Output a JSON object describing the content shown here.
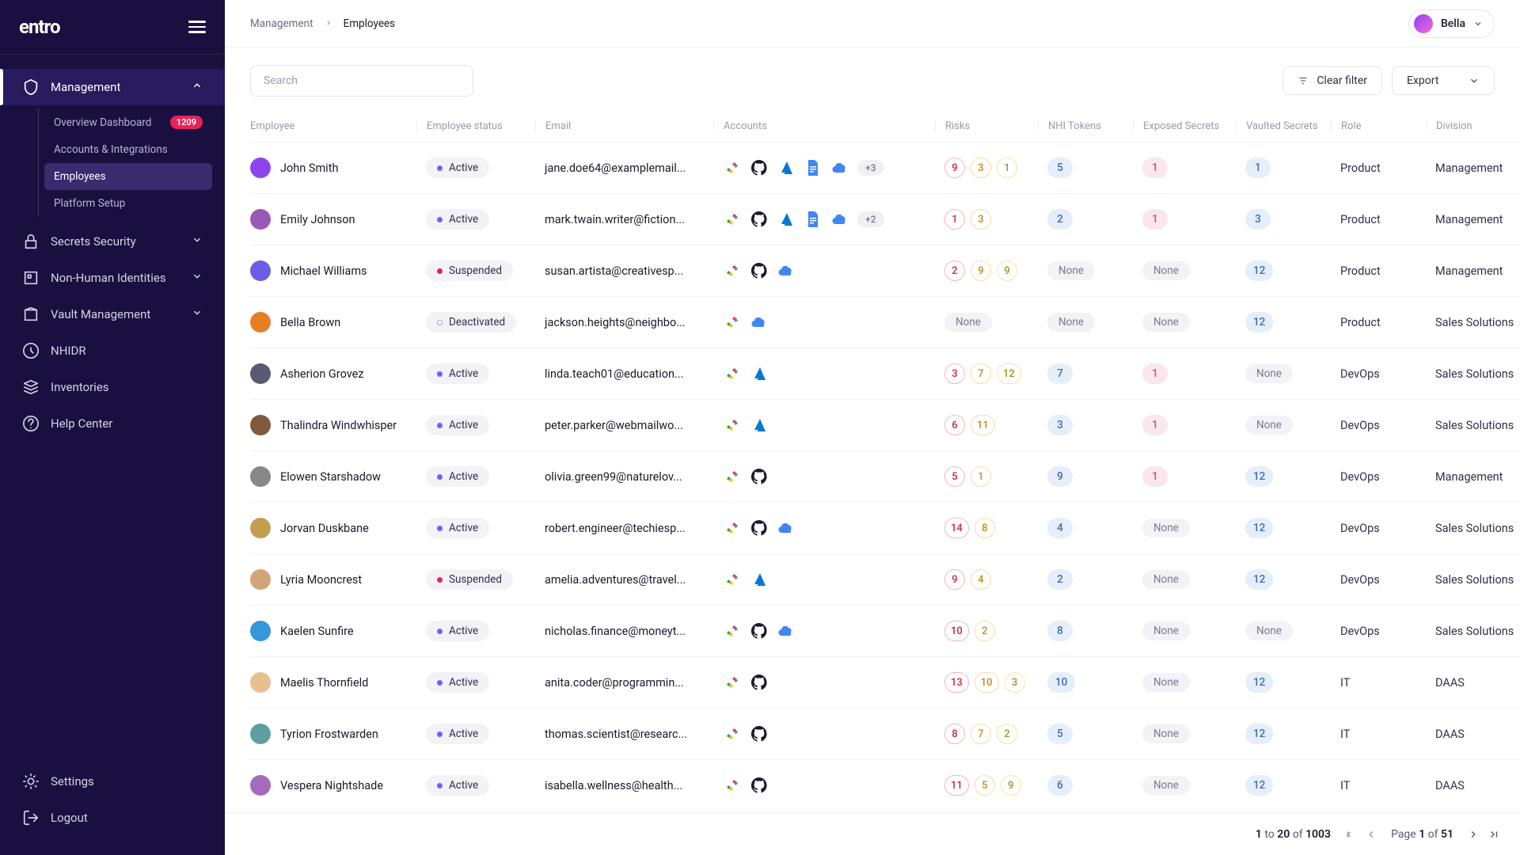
{
  "brand": "entro",
  "breadcrumb": {
    "root": "Management",
    "current": "Employees"
  },
  "user": {
    "name": "Bella",
    "avatarBg": "linear-gradient(135deg,#8e44ec,#f368e0)"
  },
  "sidebar": {
    "main": [
      {
        "label": "Management",
        "expanded": true,
        "active": true,
        "children": [
          {
            "label": "Overview Dashboard",
            "badge": "1209"
          },
          {
            "label": "Accounts & Integrations"
          },
          {
            "label": "Employees",
            "selected": true
          },
          {
            "label": "Platform Setup"
          }
        ]
      },
      {
        "label": "Secrets Security",
        "caret": true
      },
      {
        "label": "Non-Human Identities",
        "caret": true
      },
      {
        "label": "Vault Management",
        "caret": true
      },
      {
        "label": "NHIDR"
      },
      {
        "label": "Inventories"
      },
      {
        "label": "Help Center"
      }
    ],
    "bottom": [
      {
        "label": "Settings"
      },
      {
        "label": "Logout"
      }
    ]
  },
  "toolbar": {
    "searchPlaceholder": "Search",
    "clearFilter": "Clear filter",
    "export": "Export"
  },
  "columns": [
    "Employee",
    "Employee status",
    "Email",
    "Accounts",
    "Risks",
    "NHI Tokens",
    "Exposed Secrets",
    "Vaulted Secrets",
    "Role",
    "Division"
  ],
  "statuses": {
    "active": "Active",
    "suspended": "Suspended",
    "deactivated": "Deactivated"
  },
  "noneLabel": "None",
  "rows": [
    {
      "name": "John Smith",
      "avatarBg": "#8e44ec",
      "status": "active",
      "email": "jane.doe64@examplemail...",
      "accounts": [
        "gcloud",
        "github",
        "azure",
        "docs",
        "gcloud2"
      ],
      "more": "+3",
      "risks": [
        {
          "v": 9,
          "t": "red"
        },
        {
          "v": 3,
          "t": "orange"
        },
        {
          "v": 1,
          "t": "yellow"
        }
      ],
      "tokens": "5",
      "exposed": "1",
      "vaulted": "1",
      "role": "Product",
      "division": "Management"
    },
    {
      "name": "Emily Johnson",
      "avatarBg": "#9b59b6",
      "status": "active",
      "email": "mark.twain.writer@fiction...",
      "accounts": [
        "gcloud",
        "github",
        "azure",
        "docs",
        "gcloud2"
      ],
      "more": "+2",
      "risks": [
        {
          "v": 1,
          "t": "red"
        },
        {
          "v": 3,
          "t": "orange"
        }
      ],
      "tokens": "2",
      "exposed": "1",
      "vaulted": "3",
      "role": "Product",
      "division": "Management"
    },
    {
      "name": "Michael Williams",
      "avatarBg": "#6c5ce7",
      "status": "suspended",
      "email": "susan.artista@creativesp...",
      "accounts": [
        "gcloud",
        "github",
        "gcloud2"
      ],
      "risks": [
        {
          "v": 2,
          "t": "red"
        },
        {
          "v": 9,
          "t": "orange"
        },
        {
          "v": 9,
          "t": "yellow"
        }
      ],
      "tokens": "None",
      "exposed": "None",
      "vaulted": "12",
      "role": "Product",
      "division": "Management"
    },
    {
      "name": "Bella Brown",
      "avatarBg": "#e67e22",
      "status": "deactivated",
      "email": "jackson.heights@neighbo...",
      "accounts": [
        "gcloud",
        "gcloud2"
      ],
      "risks": [],
      "risksNone": true,
      "tokens": "None",
      "exposed": "None",
      "vaulted": "12",
      "role": "Product",
      "division": "Sales Solutions"
    },
    {
      "name": "Asherion Grovez",
      "avatarBg": "#5a5a72",
      "status": "active",
      "email": "linda.teach01@education...",
      "accounts": [
        "gcloud",
        "azure"
      ],
      "risks": [
        {
          "v": 3,
          "t": "red"
        },
        {
          "v": 7,
          "t": "orange"
        },
        {
          "v": 12,
          "t": "yellow"
        }
      ],
      "tokens": "7",
      "exposed": "1",
      "vaulted": "None",
      "role": "DevOps",
      "division": "Sales Solutions"
    },
    {
      "name": "Thalindra Windwhisper",
      "avatarBg": "#7f5a3c",
      "status": "active",
      "email": "peter.parker@webmailwo...",
      "accounts": [
        "gcloud",
        "azure"
      ],
      "risks": [
        {
          "v": 6,
          "t": "red"
        },
        {
          "v": 11,
          "t": "orange"
        }
      ],
      "tokens": "3",
      "exposed": "1",
      "vaulted": "None",
      "role": "DevOps",
      "division": "Sales Solutions"
    },
    {
      "name": "Elowen Starshadow",
      "avatarBg": "#888",
      "status": "active",
      "email": "olivia.green99@naturelov...",
      "accounts": [
        "gcloud",
        "github"
      ],
      "risks": [
        {
          "v": 5,
          "t": "red"
        },
        {
          "v": 1,
          "t": "orange"
        }
      ],
      "tokens": "9",
      "exposed": "1",
      "vaulted": "12",
      "role": "DevOps",
      "division": "Management"
    },
    {
      "name": "Jorvan Duskbane",
      "avatarBg": "#c0a050",
      "status": "active",
      "email": "robert.engineer@techiesp...",
      "accounts": [
        "gcloud",
        "github",
        "gcloud2"
      ],
      "risks": [
        {
          "v": 14,
          "t": "red"
        },
        {
          "v": 8,
          "t": "orange"
        }
      ],
      "tokens": "4",
      "exposed": "None",
      "vaulted": "12",
      "role": "DevOps",
      "division": "Sales Solutions"
    },
    {
      "name": "Lyria Mooncrest",
      "avatarBg": "#d4a574",
      "status": "suspended",
      "email": "amelia.adventures@travel...",
      "accounts": [
        "gcloud",
        "azure"
      ],
      "risks": [
        {
          "v": 9,
          "t": "red"
        },
        {
          "v": 4,
          "t": "orange"
        }
      ],
      "tokens": "2",
      "exposed": "None",
      "vaulted": "12",
      "role": "DevOps",
      "division": "Sales Solutions"
    },
    {
      "name": "Kaelen Sunfire",
      "avatarBg": "#3498db",
      "status": "active",
      "email": "nicholas.finance@moneyt...",
      "accounts": [
        "gcloud",
        "github",
        "gcloud2"
      ],
      "risks": [
        {
          "v": 10,
          "t": "red"
        },
        {
          "v": 2,
          "t": "orange"
        }
      ],
      "tokens": "8",
      "exposed": "None",
      "vaulted": "None",
      "role": "DevOps",
      "division": "Sales Solutions"
    },
    {
      "name": "Maelis Thornfield",
      "avatarBg": "#e8c090",
      "status": "active",
      "email": "anita.coder@programmin...",
      "accounts": [
        "gcloud",
        "github"
      ],
      "risks": [
        {
          "v": 13,
          "t": "red"
        },
        {
          "v": 10,
          "t": "orange"
        },
        {
          "v": 3,
          "t": "yellow"
        }
      ],
      "tokens": "10",
      "exposed": "None",
      "vaulted": "12",
      "role": "IT",
      "division": "DAAS"
    },
    {
      "name": "Tyrion Frostwarden",
      "avatarBg": "#5f9ea0",
      "status": "active",
      "email": "thomas.scientist@researc...",
      "accounts": [
        "gcloud",
        "github"
      ],
      "risks": [
        {
          "v": 8,
          "t": "red"
        },
        {
          "v": 7,
          "t": "orange"
        },
        {
          "v": 2,
          "t": "yellow"
        }
      ],
      "tokens": "5",
      "exposed": "None",
      "vaulted": "12",
      "role": "IT",
      "division": "DAAS"
    },
    {
      "name": "Vespera Nightshade",
      "avatarBg": "#a569bd",
      "status": "active",
      "email": "isabella.wellness@health...",
      "accounts": [
        "gcloud",
        "github"
      ],
      "risks": [
        {
          "v": 11,
          "t": "red"
        },
        {
          "v": 5,
          "t": "orange"
        },
        {
          "v": 9,
          "t": "yellow"
        }
      ],
      "tokens": "6",
      "exposed": "None",
      "vaulted": "12",
      "role": "IT",
      "division": "DAAS"
    }
  ],
  "pagination": {
    "range": "1 to 20 of 1003",
    "page": "Page 1 of 51"
  }
}
